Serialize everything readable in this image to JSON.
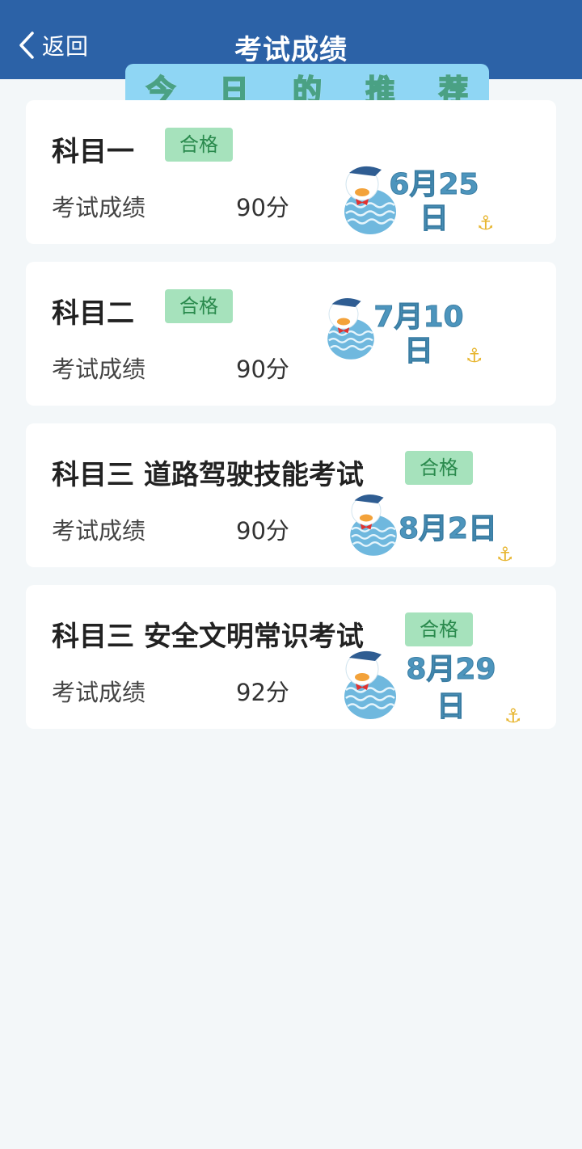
{
  "header": {
    "back_label": "返回",
    "title": "考试成绩"
  },
  "banner": {
    "chars": [
      "今",
      "日",
      "的",
      "推",
      "荐"
    ]
  },
  "results": [
    {
      "subject": "科目一",
      "status": "合格",
      "label": "考试成绩",
      "score": "90分",
      "date_line1": "6月25",
      "date_line2": "日"
    },
    {
      "subject": "科目二",
      "status": "合格",
      "label": "考试成绩",
      "score": "90分",
      "date_line1": "7月10",
      "date_line2": "日"
    },
    {
      "subject": "科目三 道路驾驶技能考试",
      "status": "合格",
      "label": "考试成绩",
      "score": "90分",
      "date_line1": "8月2日",
      "date_line2": ""
    },
    {
      "subject": "科目三 安全文明常识考试",
      "status": "合格",
      "label": "考试成绩",
      "score": "92分",
      "date_line1": "8月29",
      "date_line2": "日"
    }
  ],
  "colors": {
    "header_bg": "#2c62a7",
    "badge_bg": "#a6e2bc",
    "badge_text": "#2a8a4d",
    "page_bg": "#f3f7f9"
  },
  "icons": {
    "back": "chevron-left-icon",
    "sticker": "duck-sticker-icon",
    "anchor": "anchor-icon"
  }
}
